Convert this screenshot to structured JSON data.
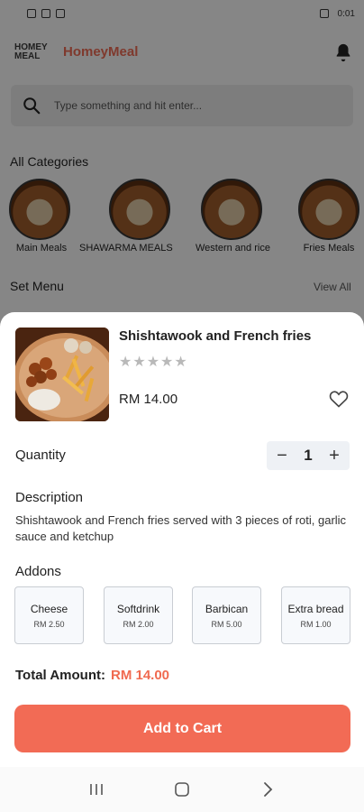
{
  "status_bar": {
    "time": "0:01"
  },
  "header": {
    "logo_text_top": "HOMEY",
    "logo_text_bottom": "MEAL",
    "app_name": "HomeyMeal",
    "bell_icon": "bell-icon"
  },
  "search": {
    "placeholder": "Type something and hit enter..."
  },
  "categories": {
    "title": "All Categories",
    "items": [
      {
        "label": "Main Meals"
      },
      {
        "label": "SHAWARMA MEALS"
      },
      {
        "label": "Western and rice"
      },
      {
        "label": "Fries Meals"
      }
    ]
  },
  "set_menu": {
    "title": "Set Menu",
    "view_all": "View All"
  },
  "product": {
    "title": "Shishtawook and French fries",
    "stars": "★★★★★",
    "rating": 0,
    "price": "RM 14.00",
    "quantity_label": "Quantity",
    "quantity": "1",
    "minus": "−",
    "plus": "+",
    "description_label": "Description",
    "description": "Shishtawook and French fries served with 3 pieces of roti, garlic sauce and ketchup",
    "addons_label": "Addons",
    "addons": [
      {
        "name": "Cheese",
        "price": "RM 2.50"
      },
      {
        "name": "Softdrink",
        "price": "RM 2.00"
      },
      {
        "name": "Barbican",
        "price": "RM 5.00"
      },
      {
        "name": "Extra bread",
        "price": "RM 1.00"
      }
    ],
    "total_label": "Total Amount:",
    "total_value": "RM 14.00",
    "add_to_cart": "Add to Cart"
  },
  "colors": {
    "accent": "#f26b55",
    "brand": "#e86952"
  }
}
